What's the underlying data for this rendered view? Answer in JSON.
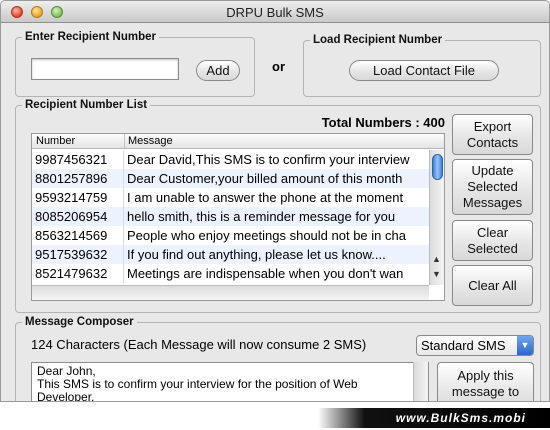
{
  "window": {
    "title": "DRPU Bulk SMS"
  },
  "enter_recipient": {
    "legend": "Enter Recipient Number",
    "input_value": "",
    "add_label": "Add"
  },
  "or_label": "or",
  "load_recipient": {
    "legend": "Load Recipient Number",
    "button_label": "Load Contact File"
  },
  "recipient_list": {
    "legend": "Recipient Number List",
    "total_label": "Total Numbers : 400",
    "columns": [
      "Number",
      "Message"
    ],
    "rows": [
      {
        "number": "9987456321",
        "message": "Dear David,This SMS is to confirm your interview"
      },
      {
        "number": "8801257896",
        "message": "Dear Customer,your billed amount of this month"
      },
      {
        "number": "9593214759",
        "message": "I am unable to answer the phone at the moment"
      },
      {
        "number": "8085206954",
        "message": "hello smith, this is a reminder message for you"
      },
      {
        "number": "8563214569",
        "message": "People who enjoy meetings should not be in cha"
      },
      {
        "number": "9517539632",
        "message": "If you find out anything, please let us know...."
      },
      {
        "number": "8521479632",
        "message": "Meetings are indispensable when you don't wan"
      }
    ],
    "buttons": {
      "export": "Export Contacts",
      "update": "Update Selected Messages",
      "clear_selected": "Clear Selected",
      "clear_all": "Clear All"
    }
  },
  "composer": {
    "legend": "Message Composer",
    "char_info": "124 Characters (Each Message will now consume 2 SMS)",
    "sms_type": "Standard SMS",
    "message_lines": [
      "Dear John,",
      "This SMS is to confirm your interview for the position of Web",
      "Developer."
    ],
    "apply_label": "Apply this message to"
  },
  "banner": {
    "text": "www.BulkSms.mobi"
  },
  "colors": {
    "accent": "#2a66c8",
    "row_alt": "#edf3fe"
  }
}
